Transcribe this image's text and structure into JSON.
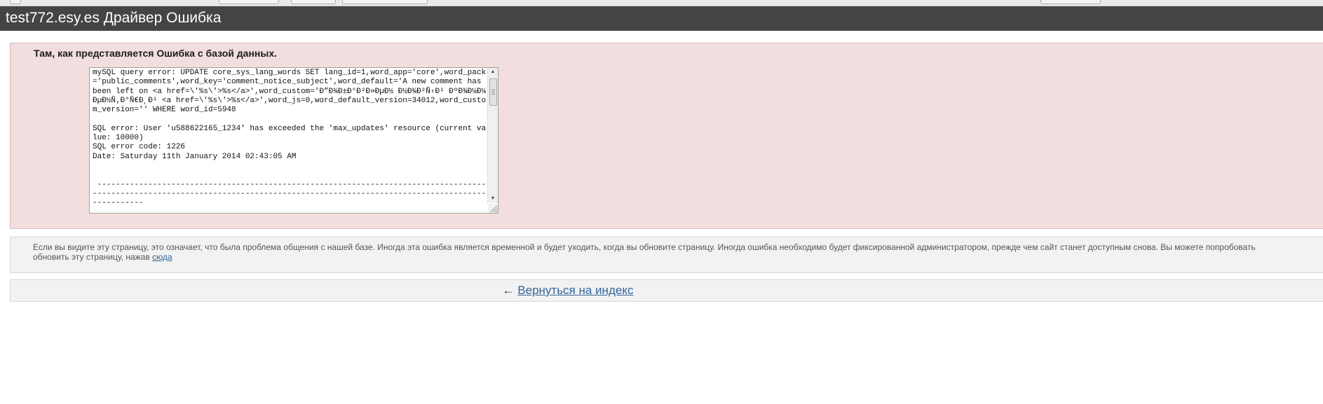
{
  "page": {
    "title": "test772.esy.es Драйвер Ошибка"
  },
  "error": {
    "heading": "Там, как представляется Ошибка с базой данных.",
    "details": "mySQL query error: UPDATE core_sys_lang_words SET lang_id=1,word_app='core',word_pack='public_comments',word_key='comment_notice_subject',word_default='A new comment has been left on <a href=\\'%s\\'>%s</a>',word_custom='Ð”Ð¾Ð±Ð°Ð²Ð»ÐµÐ½ Ð½Ð¾Ð²Ñ‹Ð¹ ÐºÐ¾Ð¼Ð¼ÐµÐ½Ñ‚Ð°Ñ€Ð¸Ð¹ <a href=\\'%s\\'>%s</a>',word_js=0,word_default_version=34012,word_custom_version='' WHERE word_id=5948\n\nSQL error: User 'u588622165_1234' has exceeded the 'max_updates' resource (current value: 10000)\nSQL error code: 1226\nDate: Saturday 11th January 2014 02:43:05 AM\n\n\n ------------------------------------------------------------------------------------------------------------------------------------------------------------------------------------"
  },
  "info": {
    "text": "Если вы видите эту страницу, это означает, что была проблема общения с нашей базе. Иногда эта ошибка является временной и будет уходить, когда вы обновите страницу. Иногда ошибка необходимо будет фиксированной администратором, прежде чем сайт станет доступным снова. Вы можете попробовать обновить эту страницу, нажав",
    "link_label": "сюда"
  },
  "back": {
    "arrow": "←",
    "link_label": "Вернуться на индекс"
  },
  "icons": {
    "scroll_up": "scroll-up-arrow-icon",
    "scroll_down": "scroll-down-arrow-icon",
    "resize": "resize-grip-icon"
  },
  "colors": {
    "header_bg": "#444444",
    "error_bg": "#f2dede",
    "panel_bg": "#f2f2f2",
    "link": "#336699"
  }
}
